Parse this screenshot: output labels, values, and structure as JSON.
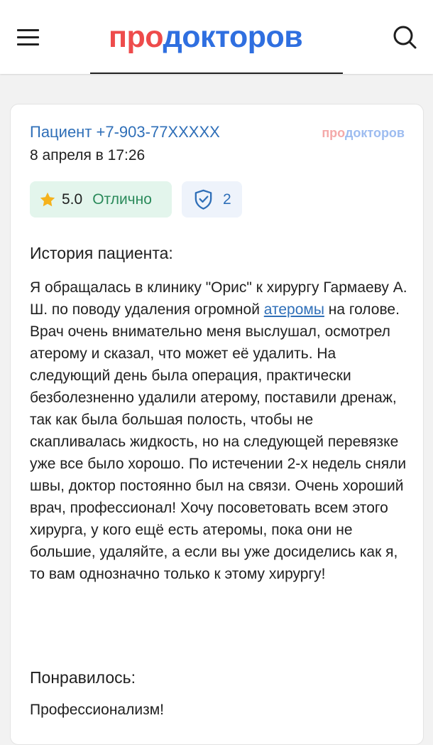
{
  "header": {
    "logo_part1": "про",
    "logo_part2": "докторов"
  },
  "review": {
    "author": "Пациент +7-903-77XXXXX",
    "date": "8 апреля в 17:26",
    "brand_part1": "про",
    "brand_part2": "докторов",
    "rating_value": "5.0",
    "rating_text": "Отлично",
    "verified_count": "2",
    "story_title": "История пациента:",
    "story_before_link": "Я обращалась в клинику \"Орис\" к хирургу Гармаеву А. Ш. по поводу удаления огромной ",
    "story_link": "атеромы",
    "story_after_link": " на голове. Врач очень внимательно меня выслушал, осмотрел атерому и сказал, что может её удалить. На следующий день была операция, практически безболезненно удалили атерому, поставили дренаж, так как была большая полость, чтобы не скапливалась жидкость, но на следующей перевязке уже все было хорошо. По истечении 2-х недель сняли швы, доктор постоянно был на связи. Очень хороший врач, профессионал! Хочу посоветовать всем этого хирурга, у кого ещё есть атеромы, пока они не большие, удаляйте, а если вы уже досиделись как я, то вам однозначно только к этому хирургу!",
    "liked_title": "Понравилось:",
    "liked_text": "Профессионализм!"
  },
  "colors": {
    "brand_red": "#ee4b4b",
    "brand_blue": "#2f6fe0",
    "link_blue": "#2f6fb8",
    "rating_green": "#2a8a5a",
    "star_yellow": "#f5b21c"
  },
  "icons": {
    "menu": "menu-icon",
    "search": "search-icon",
    "star": "star-icon",
    "shield": "shield-check-icon"
  }
}
